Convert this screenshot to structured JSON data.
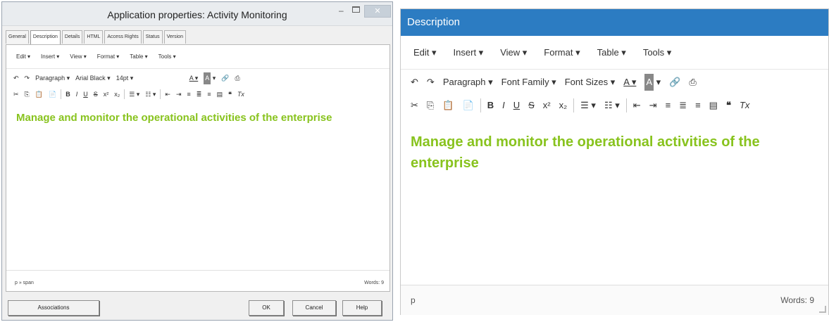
{
  "left": {
    "window_title": "Application properties: Activity Monitoring",
    "tabs": [
      "General",
      "Description",
      "Details",
      "HTML",
      "Access Rights",
      "Status",
      "Version"
    ],
    "menu": [
      "Edit ▾",
      "Insert ▾",
      "View ▾",
      "Format ▾",
      "Table ▾",
      "Tools ▾"
    ],
    "toolbar": {
      "format": "Paragraph ▾",
      "font_family": "Arial Black ▾",
      "font_size": "14pt ▾"
    },
    "content": "Manage and monitor the operational activities of the enterprise",
    "statusbar": {
      "path": "p » span",
      "words": "Words: 9"
    },
    "buttons": {
      "associations": "Associations",
      "ok": "OK",
      "cancel": "Cancel",
      "help": "Help"
    }
  },
  "right": {
    "header": "Description",
    "menu": [
      "Edit ▾",
      "Insert ▾",
      "View ▾",
      "Format ▾",
      "Table ▾",
      "Tools ▾"
    ],
    "toolbar": {
      "format": "Paragraph ▾",
      "font_family": "Font Family ▾",
      "font_size": "Font Sizes ▾"
    },
    "content": "Manage and monitor the operational activities of the enterprise",
    "statusbar": {
      "path": "p",
      "words": "Words: 9"
    }
  },
  "colors": {
    "content_text": "#88c31e",
    "header_bg": "#2c7cc2"
  },
  "icons": [
    "undo",
    "redo",
    "font-color",
    "highlight-color",
    "link",
    "print",
    "cut",
    "copy",
    "paste",
    "paste-text",
    "bold",
    "italic",
    "underline",
    "strikethrough",
    "superscript",
    "subscript",
    "bullet-list",
    "numbered-list",
    "outdent",
    "indent",
    "align-left",
    "align-center",
    "align-right",
    "justify",
    "blockquote",
    "clear-formatting"
  ]
}
